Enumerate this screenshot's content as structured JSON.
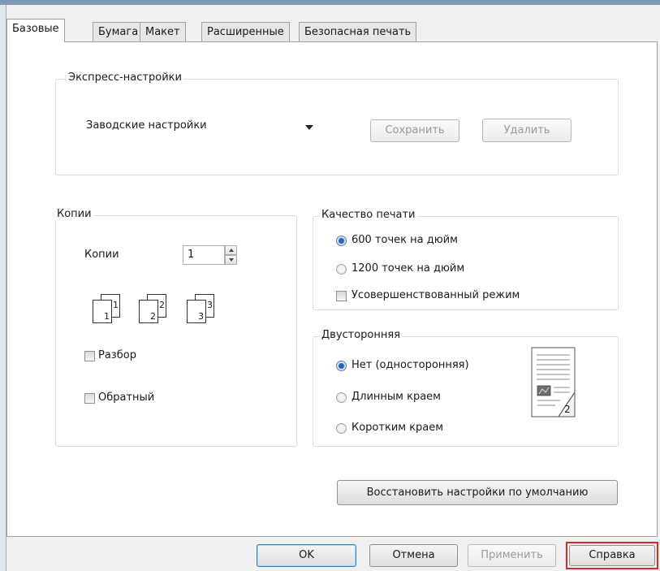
{
  "tabs": [
    {
      "label": "Базовые",
      "active": true
    },
    {
      "label": "Бумага",
      "active": false
    },
    {
      "label": "Макет",
      "active": false
    },
    {
      "label": "Расширенные",
      "active": false
    },
    {
      "label": "Безопасная печать",
      "active": false
    }
  ],
  "express": {
    "legend": "Экспресс-настройки",
    "selected": "Заводские настройки",
    "save_label": "Сохранить",
    "delete_label": "Удалить"
  },
  "copies": {
    "legend": "Копии",
    "count_label": "Копии",
    "count_value": "1",
    "collate_pages": [
      "1",
      "1",
      "2",
      "2",
      "3",
      "3"
    ],
    "collate_label": "Разбор",
    "collate_checked": false,
    "reverse_label": "Обратный",
    "reverse_checked": false
  },
  "quality": {
    "legend": "Качество печати",
    "options": [
      {
        "label": "600 точек на дюйм",
        "selected": true
      },
      {
        "label": "1200 точек на дюйм",
        "selected": false
      }
    ],
    "enhanced_label": "Усовершенствованный режим",
    "enhanced_checked": false
  },
  "duplex": {
    "legend": "Двусторонняя",
    "options": [
      {
        "label": "Нет (односторонняя)",
        "selected": true
      },
      {
        "label": "Длинным краем",
        "selected": false
      },
      {
        "label": "Коротким краем",
        "selected": false
      }
    ],
    "preview_page_number": "2"
  },
  "restore_label": "Восстановить настройки по умолчанию",
  "footer": {
    "ok_label": "OK",
    "cancel_label": "Отмена",
    "apply_label": "Применить",
    "help_label": "Справка"
  },
  "colors": {
    "highlight": "#d9252b",
    "radio_selected": "#2a64b7",
    "window_frame": "#7f96b4"
  }
}
